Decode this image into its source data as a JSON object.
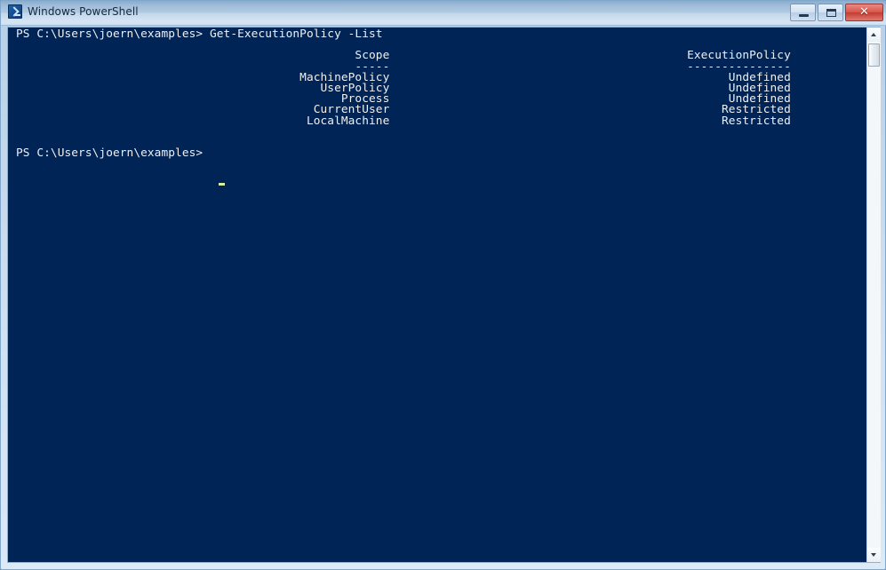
{
  "window": {
    "title": "Windows PowerShell",
    "icon": "powershell-icon",
    "background_color": "#012456",
    "text_color": "#f0f0f0",
    "controls": {
      "minimize_label": "–",
      "maximize_label": "□",
      "close_label": "✕"
    }
  },
  "scrollbar": {
    "up_arrow": "▲",
    "down_arrow": "▼"
  },
  "console": {
    "prompt_path": "PS C:\\Users\\joern\\examples>",
    "command": "Get-ExecutionPolicy -List",
    "command_line": "PS C:\\Users\\joern\\examples> Get-ExecutionPolicy -List",
    "table": {
      "columns": [
        "Scope",
        "ExecutionPolicy"
      ],
      "separators": [
        "-----",
        "---------------"
      ],
      "rows": [
        {
          "scope": "MachinePolicy",
          "policy": "Undefined"
        },
        {
          "scope": "UserPolicy",
          "policy": "Undefined"
        },
        {
          "scope": "Process",
          "policy": "Undefined"
        },
        {
          "scope": "CurrentUser",
          "policy": "Restricted"
        },
        {
          "scope": "LocalMachine",
          "policy": "Restricted"
        }
      ]
    },
    "final_prompt": "PS C:\\Users\\joern\\examples>",
    "rendered_text": "PS C:\\Users\\joern\\examples> Get-ExecutionPolicy -List\n\n                                                 Scope                                           ExecutionPolicy\n                                                 -----                                           ---------------\n                                         MachinePolicy                                                 Undefined\n                                            UserPolicy                                                 Undefined\n                                               Process                                                 Undefined\n                                           CurrentUser                                                Restricted\n                                          LocalMachine                                                Restricted\n\n\nPS C:\\Users\\joern\\examples> "
  }
}
